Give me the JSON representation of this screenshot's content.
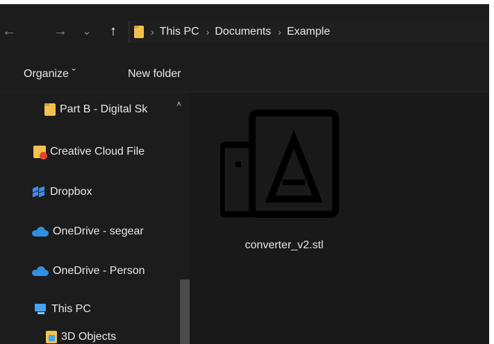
{
  "nav": {
    "back_icon": "←",
    "forward_icon": "→",
    "recent_icon": "⌄",
    "up_icon": "↑"
  },
  "address": {
    "separator": "›",
    "crumbs": [
      "This PC",
      "Documents",
      "Example"
    ]
  },
  "toolbar": {
    "organize": "Organize ˇ",
    "new_folder": "New folder"
  },
  "sidebar": {
    "items": [
      {
        "label": "Part B - Digital Sk",
        "icon": "folder-icon"
      },
      {
        "label": "Creative Cloud File",
        "icon": "creative-cloud-icon"
      },
      {
        "label": "Dropbox",
        "icon": "dropbox-icon"
      },
      {
        "label": "OneDrive - segear",
        "icon": "onedrive-icon"
      },
      {
        "label": "OneDrive - Person",
        "icon": "onedrive-icon"
      },
      {
        "label": "This PC",
        "icon": "this-pc-icon"
      },
      {
        "label": "3D Objects",
        "icon": "3d-objects-icon"
      }
    ],
    "scroll_up": "˄"
  },
  "files": [
    {
      "name": "converter_v2.stl",
      "icon": "stl-file-icon"
    }
  ],
  "colors": {
    "background": "#191919",
    "pane": "#1c1c1c",
    "folder": "#f2c14e",
    "onedrive": "#2f8fe0"
  }
}
